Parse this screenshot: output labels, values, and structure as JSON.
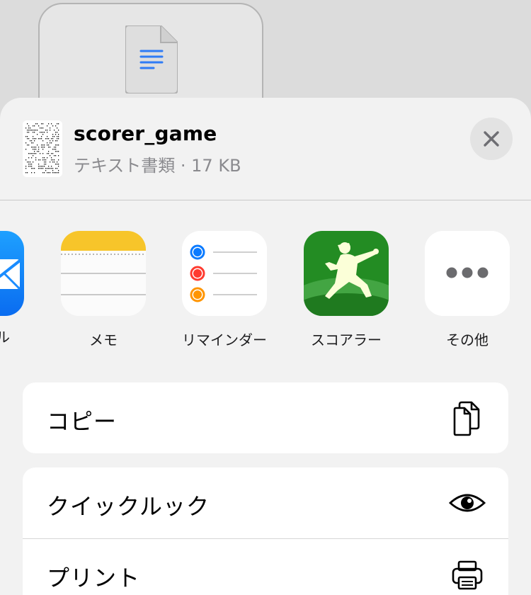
{
  "file": {
    "name": "scorer_game",
    "meta": "テキスト書類 · 17 KB"
  },
  "apps": {
    "partial_label": "ル",
    "items": [
      {
        "label": "メモ",
        "icon": "notes-app-icon"
      },
      {
        "label": "リマインダー",
        "icon": "reminders-app-icon"
      },
      {
        "label": "スコアラー",
        "icon": "scorer-app-icon"
      },
      {
        "label": "その他",
        "icon": "more-icon"
      }
    ]
  },
  "actions": {
    "copy": {
      "label": "コピー",
      "icon": "copy-icon"
    },
    "quicklook": {
      "label": "クイックルック",
      "icon": "eye-icon"
    },
    "print": {
      "label": "プリント",
      "icon": "printer-icon"
    }
  },
  "colors": {
    "sheet_bg": "#f2f2f2",
    "notes_yellow": "#f7c52a",
    "reminder_blue": "#0a7aff",
    "reminder_red": "#ff3b30",
    "reminder_orange": "#ff9500",
    "scorer_green": "#2e8b2e",
    "mail_blue": "#1a8cff"
  }
}
